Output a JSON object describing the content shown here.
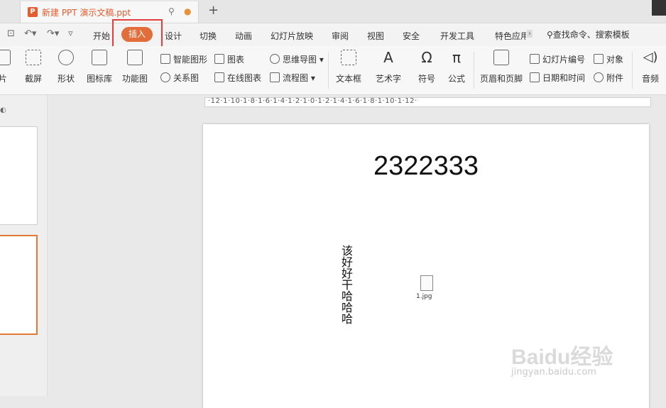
{
  "tabbar": {
    "doc_title": "新建 PPT 演示文稿.ppt",
    "doc_badge": "P",
    "add_tab": "+"
  },
  "menu": {
    "items": [
      "开始",
      "插入",
      "设计",
      "切换",
      "动画",
      "幻灯片放映",
      "审阅",
      "视图",
      "安全",
      "开发工具",
      "特色应用"
    ],
    "search": "查找命令、搜索模板",
    "active": "插入"
  },
  "ribbon": {
    "big": [
      "片",
      "截屏",
      "形状",
      "图标库",
      "功能图",
      "文本框",
      "艺术字",
      "符号",
      "公式",
      "页眉和页脚",
      "音频"
    ],
    "small_top": [
      "智能图形",
      "图表",
      "思维导图",
      "幻灯片编号",
      "对象"
    ],
    "small_bottom": [
      "关系图",
      "在线图表",
      "流程图",
      "日期和时间",
      "附件"
    ]
  },
  "ruler": {
    "labels": "·12·1·10·1·8·1·6·1·4·1·2·1·0·1·2·1·4·1·6·1·8·1·10·1·12·"
  },
  "slide": {
    "title": "2322333",
    "vertical_text": "该好好干哈哈哈",
    "file_label": "1.jpg"
  },
  "watermark": {
    "main": "Baidu经验",
    "sub": "jingyan.baidu.com"
  },
  "colors": {
    "accent": "#e26c3a",
    "highlight": "#e33d3d"
  }
}
